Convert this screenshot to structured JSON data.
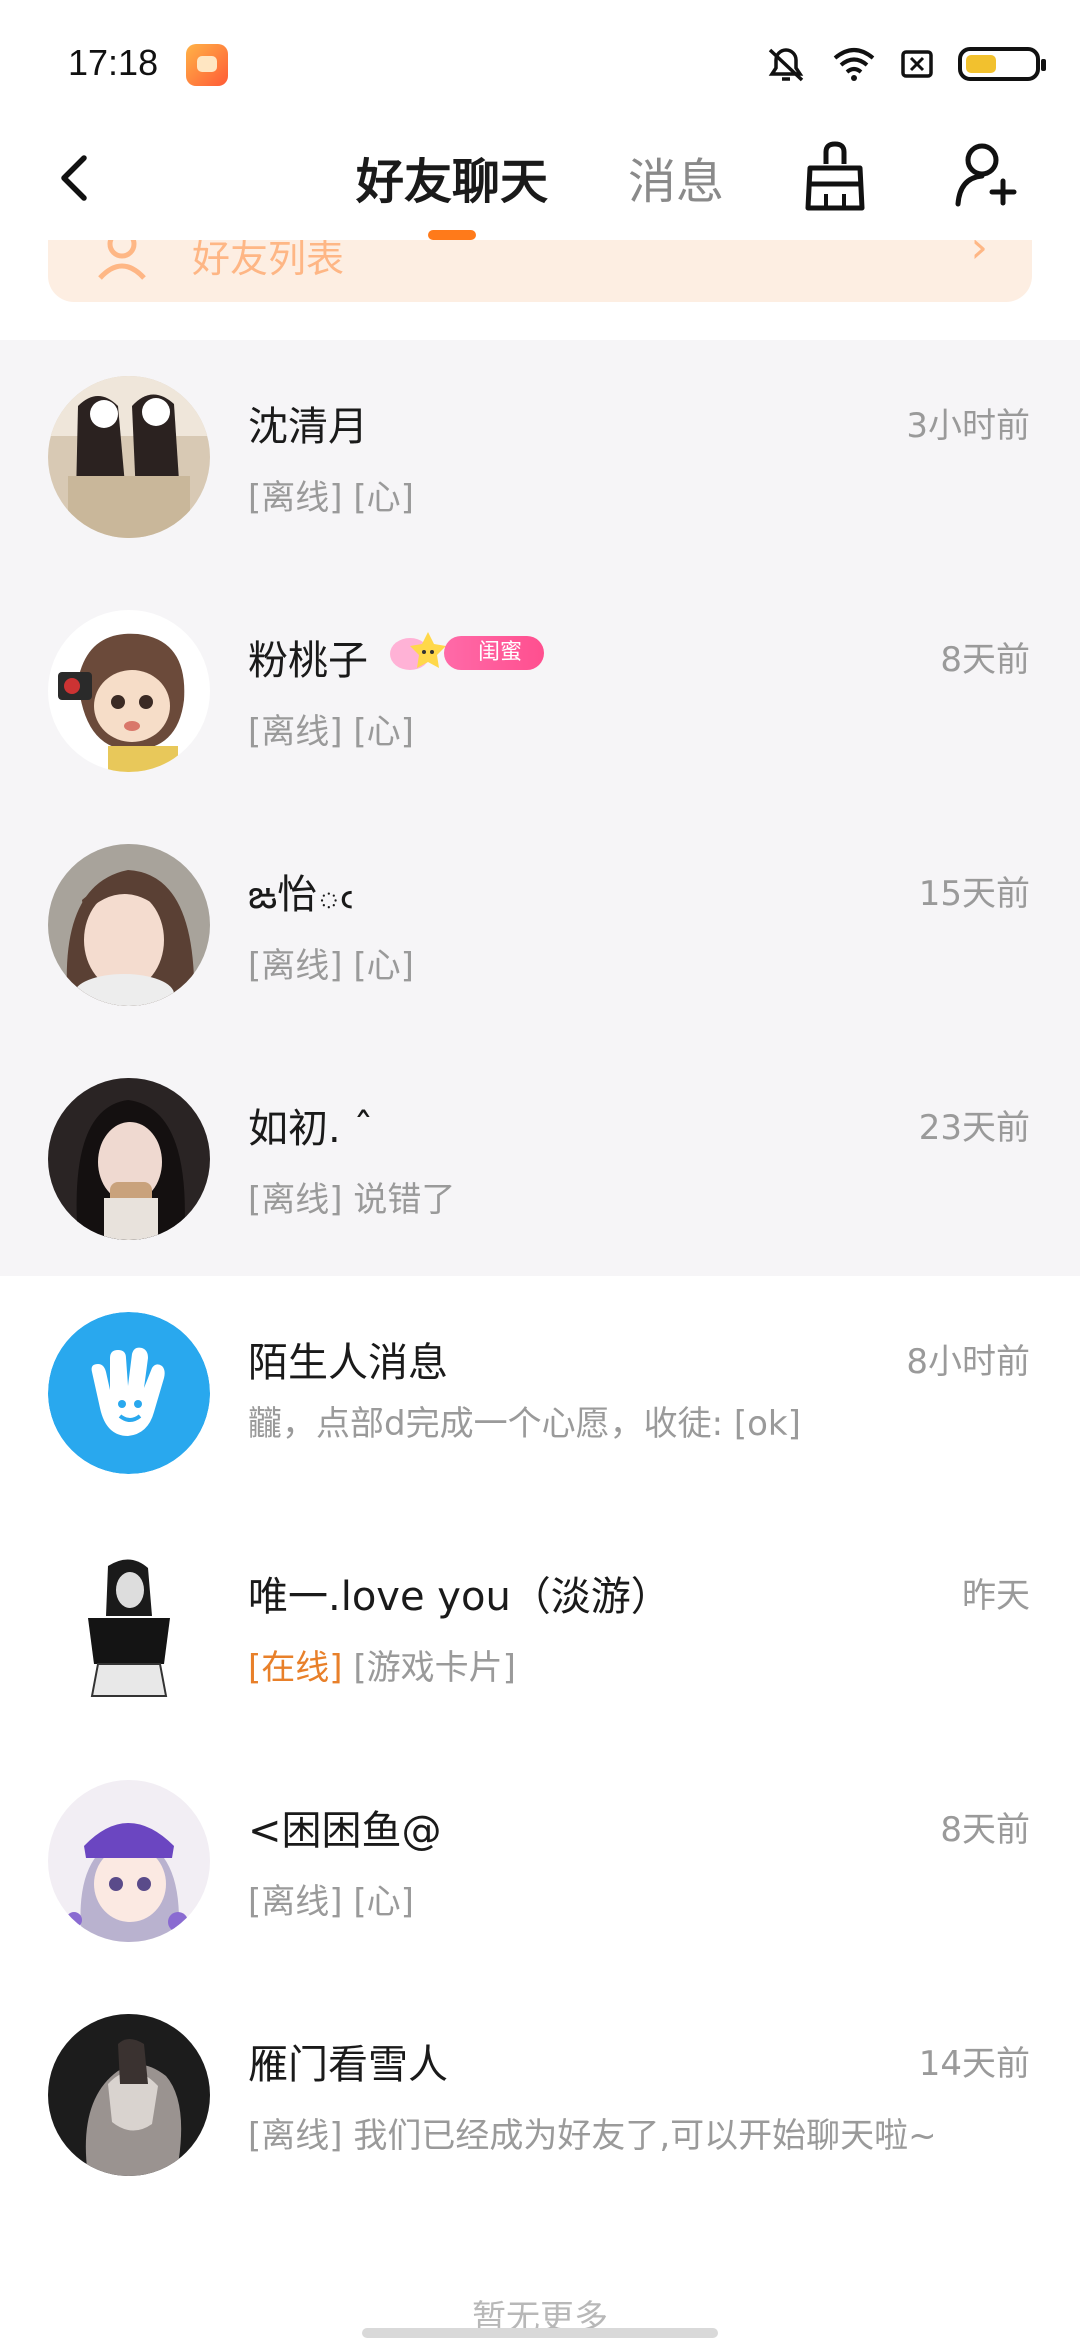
{
  "status_bar": {
    "time": "17:18"
  },
  "header": {
    "tabs": [
      {
        "label": "好友聊天",
        "active": true
      },
      {
        "label": "消息",
        "active": false
      }
    ]
  },
  "banner": {
    "label": "好友列表"
  },
  "chats": [
    {
      "name": "沈清月",
      "time": "3小时前",
      "status": "[离线]",
      "preview": "[心]"
    },
    {
      "name": "粉桃子",
      "badge": "闺蜜",
      "time": "8天前",
      "status": "[离线]",
      "preview": "[心]"
    },
    {
      "name": "ఙ怡ఁ",
      "time": "15天前",
      "status": "[离线]",
      "preview": "[心]"
    },
    {
      "name": "如初. ˆ",
      "time": "23天前",
      "status": "[离线]",
      "preview": "说错了"
    },
    {
      "name": "陌生人消息",
      "time": "8小时前",
      "status": "",
      "preview": "龖，点部d完成一个心愿，收徒: [ok]"
    },
    {
      "name": "唯一.love you（淡游）",
      "time": "昨天",
      "status": "[在线]",
      "preview": "[游戏卡片]"
    },
    {
      "name": "<困困鱼@",
      "time": "8天前",
      "status": "[离线]",
      "preview": "[心]"
    },
    {
      "name": "雁门看雪人",
      "time": "14天前",
      "status": "[离线]",
      "preview": "我们已经成为好友了,可以开始聊天啦~"
    }
  ],
  "footer": {
    "text": "暂无更多"
  },
  "colors": {
    "accent": "#ff7a1a",
    "online": "#e8802a",
    "badge": "#ff4f8f",
    "stranger_avatar": "#29a8ee"
  }
}
